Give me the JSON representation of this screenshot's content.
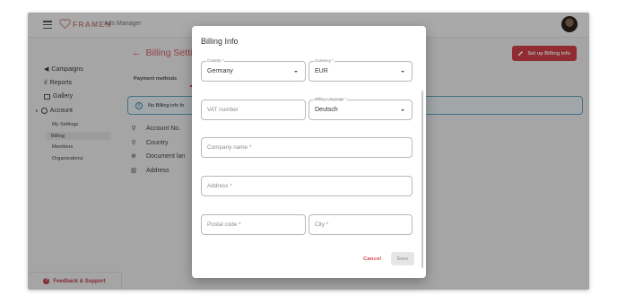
{
  "app": {
    "brand": "FRAMEN",
    "subtitle": "Ads Manager"
  },
  "sidebar": {
    "items": [
      {
        "label": "Campaigns",
        "icon": "megaphone-icon"
      },
      {
        "label": "Reports",
        "icon": "bar-chart-icon"
      },
      {
        "label": "Gallery",
        "icon": "image-icon"
      },
      {
        "label": "Account",
        "icon": "account-circle-icon"
      }
    ],
    "account_sub": [
      {
        "label": "My Settings"
      },
      {
        "label": "Billing",
        "active": true
      },
      {
        "label": "Members"
      },
      {
        "label": "Organizations"
      }
    ],
    "feedback_label": "Feedback & Support"
  },
  "main": {
    "title": "Billing Setti",
    "setup_button": "Set up Billing info",
    "tab_label": "Payment methods",
    "info_text": "No Billing info fo",
    "details": [
      {
        "label": "Account No.",
        "icon": "person-icon"
      },
      {
        "label": "Country",
        "icon": "location-pin-icon"
      },
      {
        "label": "Document lan",
        "icon": "globe-icon"
      },
      {
        "label": "Address",
        "icon": "map-icon"
      }
    ]
  },
  "modal": {
    "title": "Billing Info",
    "country": {
      "label": "Country *",
      "value": "Germany"
    },
    "currency": {
      "label": "Currency *",
      "value": "EUR"
    },
    "vat": {
      "placeholder": "VAT number"
    },
    "billing_language": {
      "label": "Billing Language *",
      "value": "Deutsch"
    },
    "company_name": {
      "placeholder": "Company name *"
    },
    "address": {
      "placeholder": "Address *"
    },
    "postal_code": {
      "placeholder": "Postal code *"
    },
    "city": {
      "placeholder": "City *"
    },
    "cancel_label": "Cancel",
    "save_label": "Save"
  },
  "colors": {
    "accent": "#d6424c",
    "info_border": "#6aa6c6"
  }
}
